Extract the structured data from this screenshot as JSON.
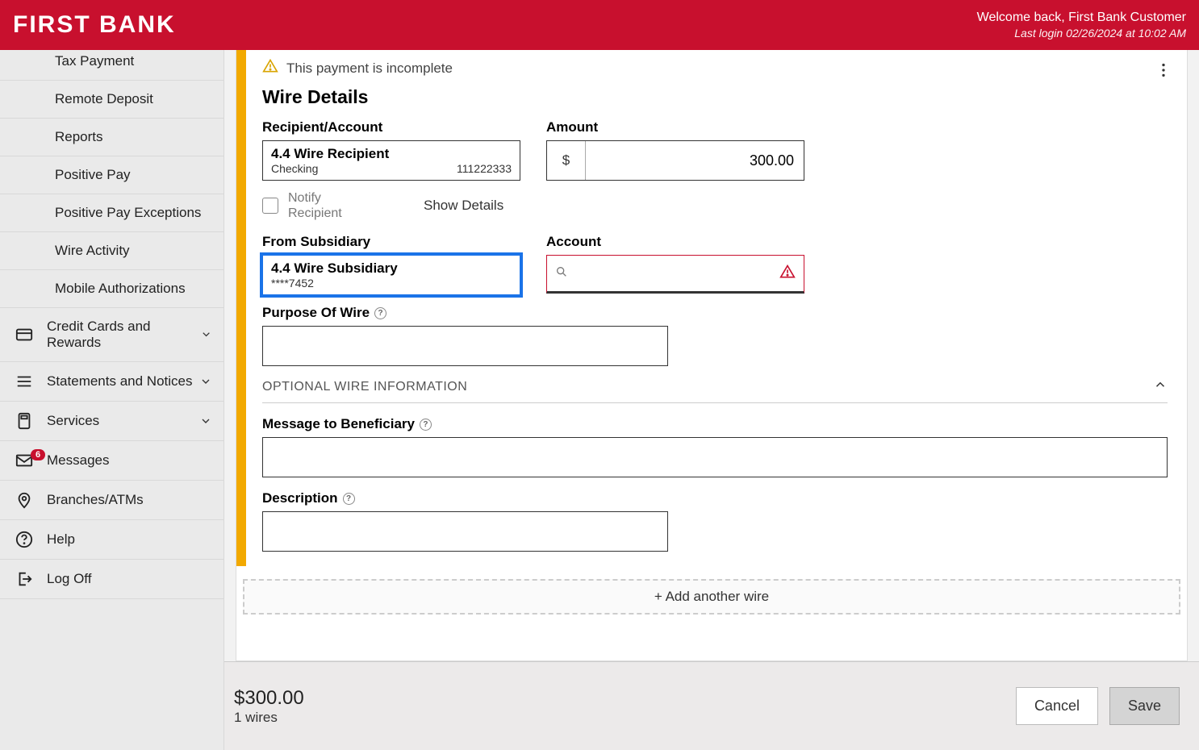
{
  "header": {
    "logo": "FIRST BANK",
    "welcome": "Welcome back, First Bank Customer",
    "last_login": "Last login 02/26/2024 at 10:02 AM"
  },
  "sidebar": {
    "sub_items": [
      "Tax Payment",
      "Remote Deposit",
      "Reports",
      "Positive Pay",
      "Positive Pay Exceptions",
      "Wire Activity",
      "Mobile Authorizations"
    ],
    "credit_cards": "Credit Cards and Rewards",
    "statements": "Statements and Notices",
    "services": "Services",
    "messages": "Messages",
    "messages_badge": "6",
    "branches": "Branches/ATMs",
    "help": "Help",
    "logoff": "Log Off"
  },
  "wire": {
    "incomplete_msg": "This payment is incomplete",
    "title": "Wire Details",
    "recipient_label": "Recipient/Account",
    "recipient_name": "4.4 Wire Recipient",
    "recipient_acct_type": "Checking",
    "recipient_acct_num": "111222333",
    "amount_label": "Amount",
    "amount_prefix": "$",
    "amount_value": "300.00",
    "notify_label": "Notify Recipient",
    "show_details": "Show Details",
    "from_sub_label": "From Subsidiary",
    "from_sub_name": "4.4 Wire Subsidiary",
    "from_sub_masked": "****7452",
    "account_label": "Account",
    "purpose_label": "Purpose Of Wire",
    "optional_header": "OPTIONAL WIRE INFORMATION",
    "msg_benef_label": "Message to Beneficiary",
    "description_label": "Description",
    "add_another": "+ Add another wire"
  },
  "footer": {
    "total": "$300.00",
    "count": "1 wires",
    "cancel": "Cancel",
    "save": "Save"
  },
  "a11y": {
    "q": "?"
  }
}
